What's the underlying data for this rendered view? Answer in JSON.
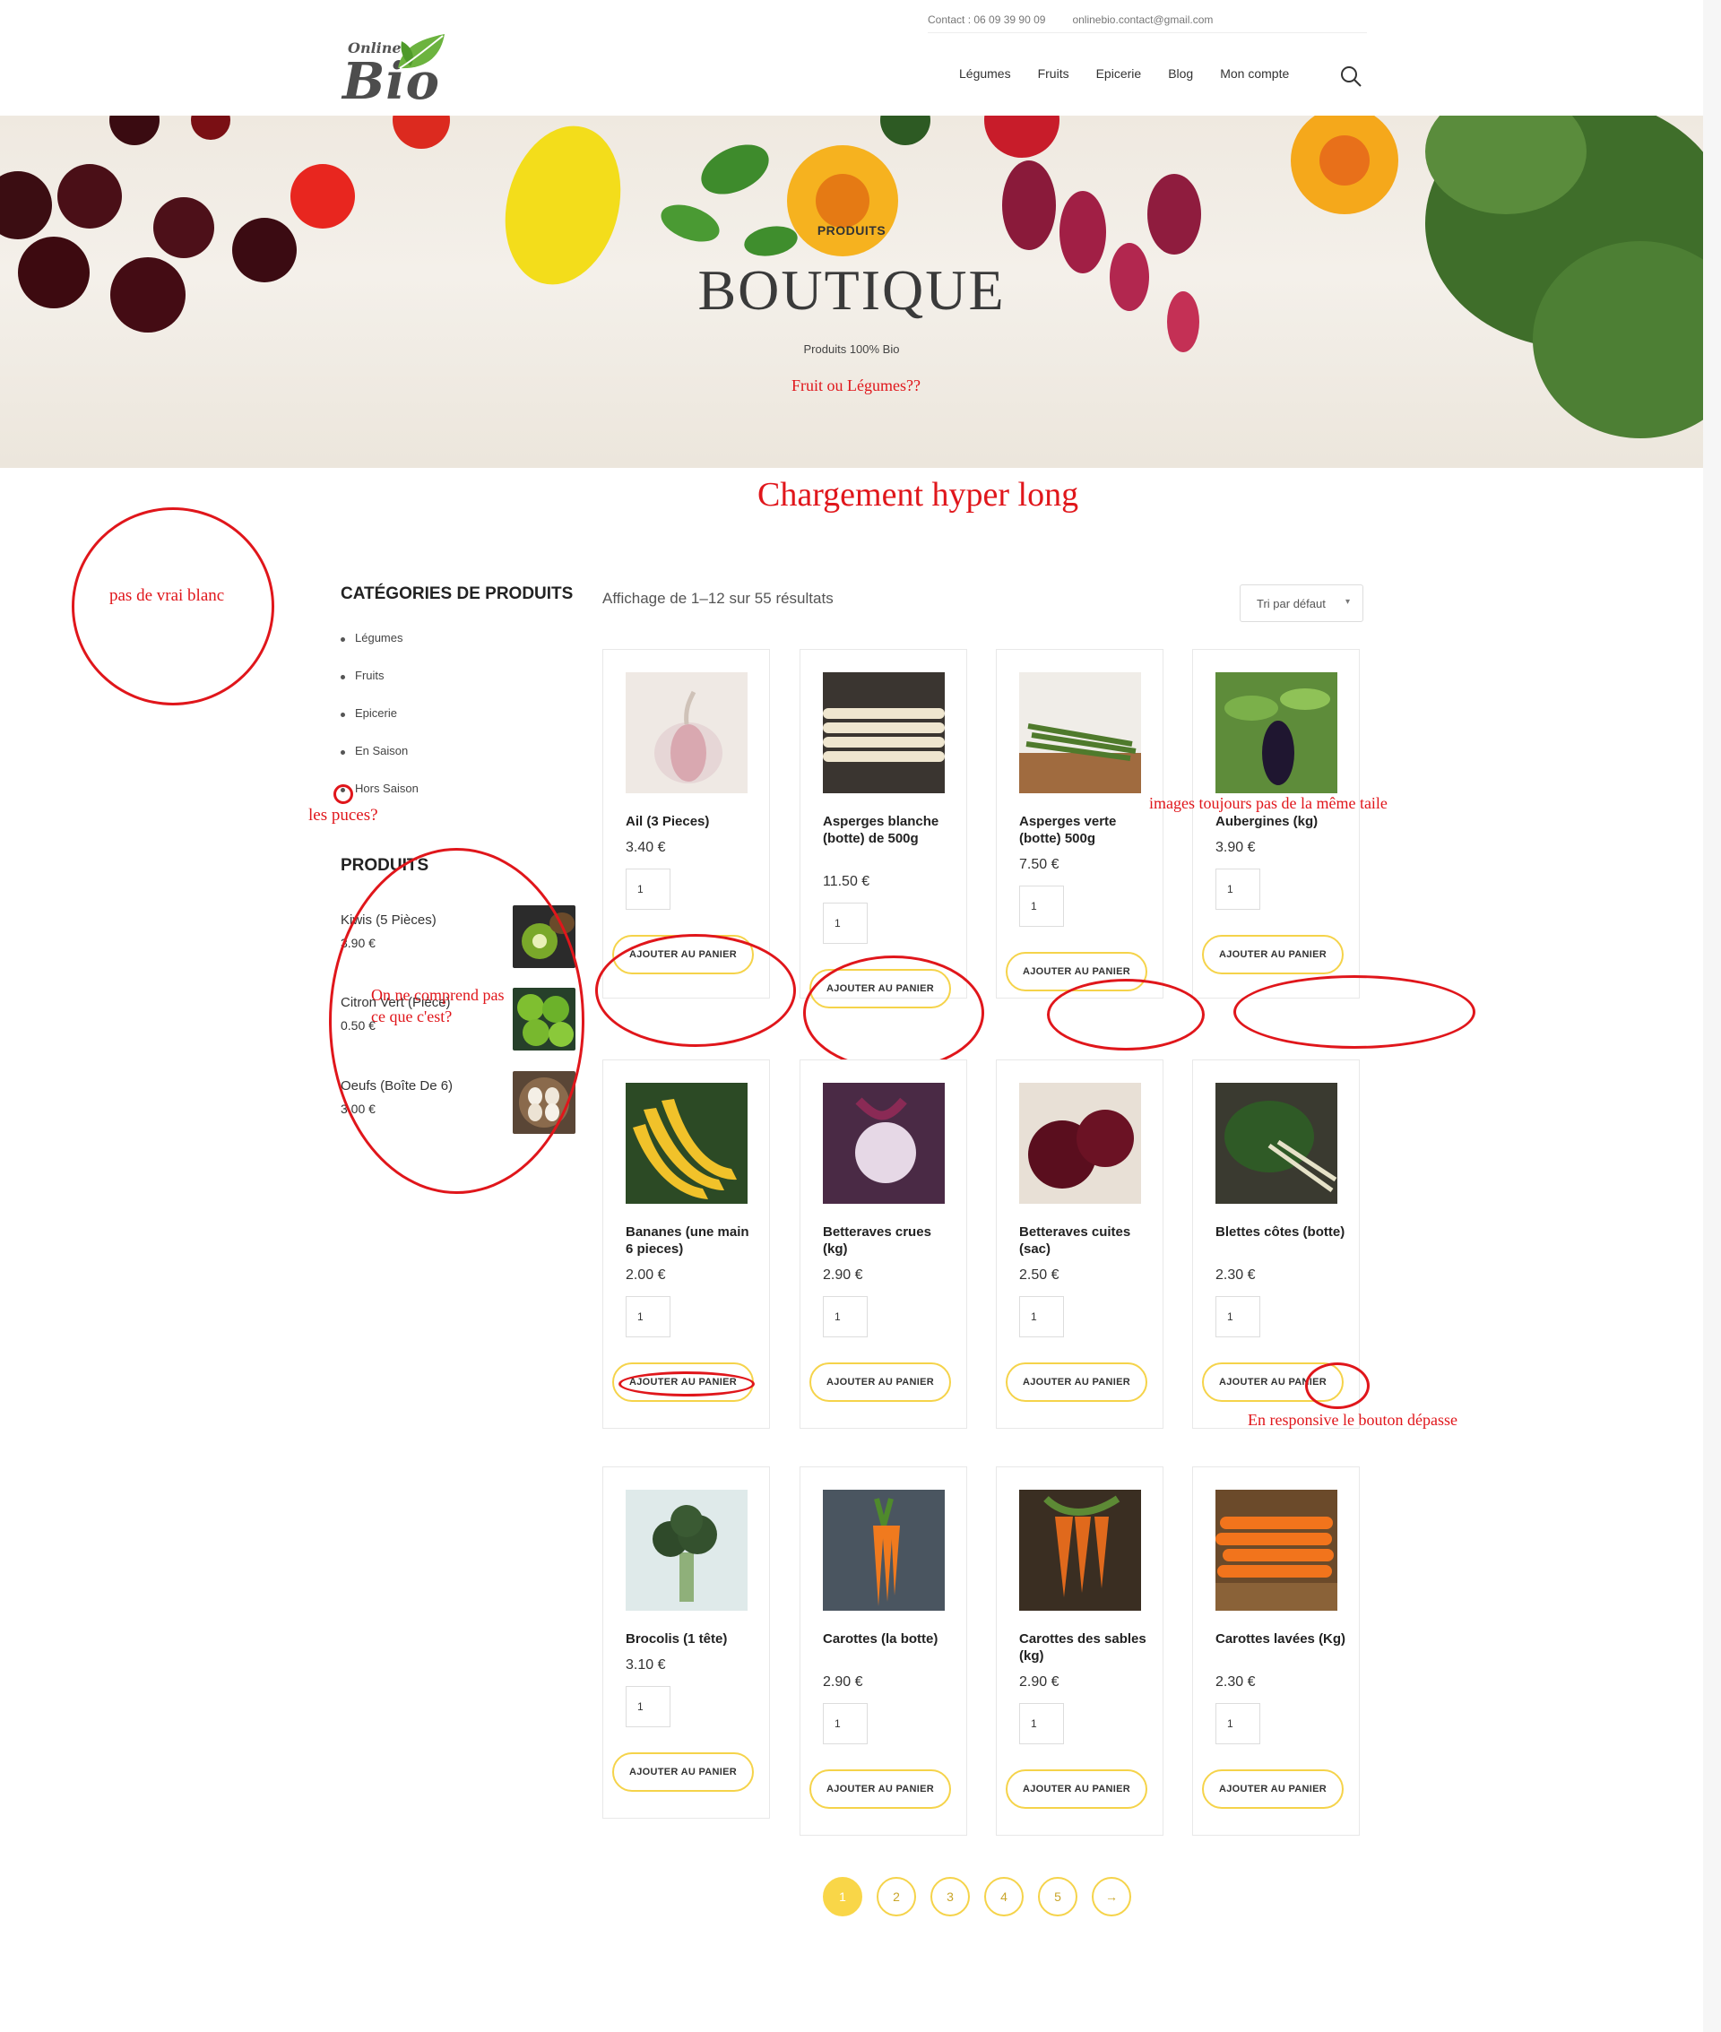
{
  "header": {
    "contact": "Contact : 06 09 39 90 09",
    "email": "onlinebio.contact@gmail.com",
    "logo_small": "Online",
    "logo_big": "Bio",
    "nav": [
      "Légumes",
      "Fruits",
      "Epicerie",
      "Blog",
      "Mon compte"
    ],
    "search_icon": "search-icon"
  },
  "hero": {
    "subtitle": "PRODUITS",
    "title": "BOUTIQUE",
    "tagline": "Produits 100% Bio"
  },
  "annotations": {
    "hero_question": "Fruit ou Légumes??",
    "loading": "Chargement hyper long",
    "white": "pas de vrai blanc",
    "bullets": "les puces?",
    "images": "images toujours pas de la même taile",
    "unclear_line1": "On ne comprend pas",
    "unclear_line2": "ce que c'est?",
    "responsive": "En responsive le bouton dépasse"
  },
  "sidebar": {
    "categories_title": "CATÉGORIES DE PRODUITS",
    "categories": [
      "Légumes",
      "Fruits",
      "Epicerie",
      "En Saison",
      "Hors Saison"
    ],
    "products_title": "PRODUITS",
    "products": [
      {
        "name": "Kiwis (5 Pièces)",
        "price": "3.90 €"
      },
      {
        "name": "Citron Vert (Pièce)",
        "price": "0.50 €"
      },
      {
        "name": "Oeufs (Boîte De 6)",
        "price": "3.00 €"
      }
    ]
  },
  "shop": {
    "result_count": "Affichage de 1–12 sur 55 résultats",
    "sort_label": "Tri par défaut",
    "add_label": "AJOUTER AU PANIER",
    "qty_default": "1",
    "products": [
      {
        "name": "Ail (3 Pieces)",
        "price": "3.40 €"
      },
      {
        "name": "Asperges blanche (botte) de 500g",
        "price": "11.50 €"
      },
      {
        "name": "Asperges verte (botte) 500g",
        "price": "7.50 €"
      },
      {
        "name": "Aubergines (kg)",
        "price": "3.90 €"
      },
      {
        "name": "Bananes (une main 6 pieces)",
        "price": "2.00 €"
      },
      {
        "name": "Betteraves crues (kg)",
        "price": "2.90 €"
      },
      {
        "name": "Betteraves cuites (sac)",
        "price": "2.50 €"
      },
      {
        "name": "Blettes côtes (botte)",
        "price": "2.30 €"
      },
      {
        "name": "Brocolis (1 tête)",
        "price": "3.10 €"
      },
      {
        "name": "Carottes (la botte)",
        "price": "2.90 €"
      },
      {
        "name": "Carottes des sables (kg)",
        "price": "2.90 €"
      },
      {
        "name": "Carottes lavées (Kg)",
        "price": "2.30 €"
      }
    ]
  },
  "pagination": [
    "1",
    "2",
    "3",
    "4",
    "5",
    "→"
  ],
  "colors": {
    "accent": "#f9d648",
    "annotation": "#e0161b"
  }
}
